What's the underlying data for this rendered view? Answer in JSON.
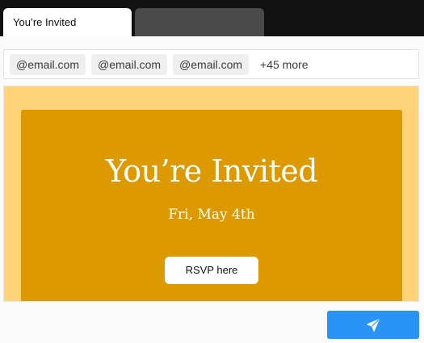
{
  "tabs": [
    {
      "label": "You’re Invited",
      "active": true
    },
    {
      "label": "",
      "active": false
    }
  ],
  "recipients": {
    "chips": [
      "@email.com",
      "@email.com",
      "@email.com"
    ],
    "more_label": "+45 more"
  },
  "invite": {
    "title": "You’re Invited",
    "date": "Fri, May 4th",
    "rsvp_label": "RSVP here"
  },
  "send_button": {
    "icon": "paper-plane-icon"
  },
  "colors": {
    "tabbar": "#121212",
    "preview_background": "#ffd478",
    "card_background": "#dd9900",
    "send_button": "#2994f5"
  }
}
